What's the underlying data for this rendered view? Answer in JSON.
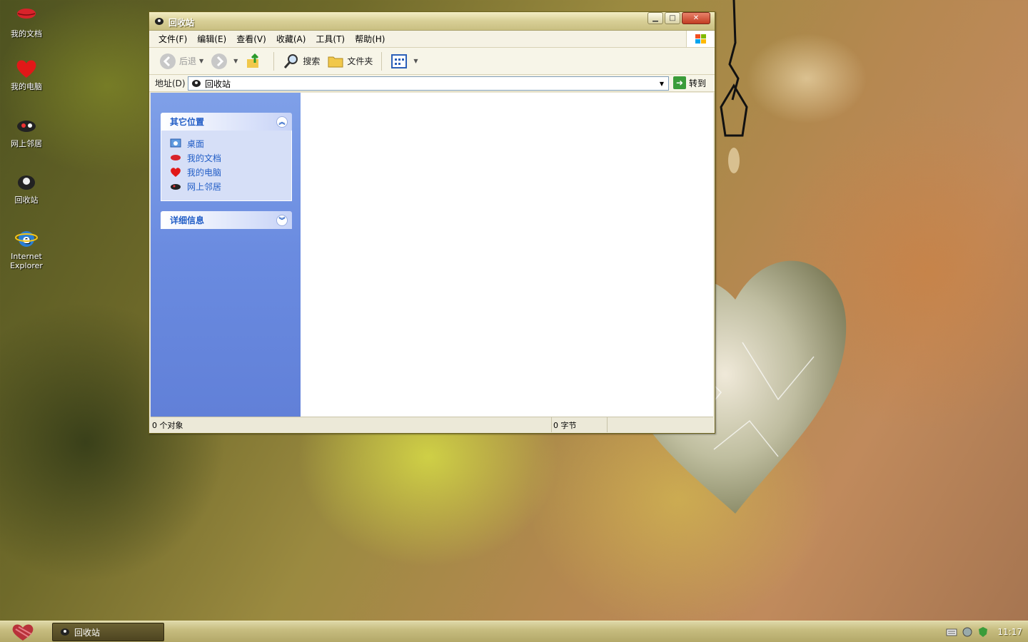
{
  "desktop": {
    "icons": [
      {
        "label": "我的文档",
        "icon": "lips-icon"
      },
      {
        "label": "我的电脑",
        "icon": "heart-icon"
      },
      {
        "label": "网上邻居",
        "icon": "network-icon"
      },
      {
        "label": "回收站",
        "icon": "recycle-bin-icon"
      },
      {
        "label": "Internet\nExplorer",
        "icon": "ie-icon"
      }
    ]
  },
  "window": {
    "title": "回收站",
    "menu": [
      "文件(F)",
      "编辑(E)",
      "查看(V)",
      "收藏(A)",
      "工具(T)",
      "帮助(H)"
    ],
    "toolbar": {
      "back": "后退",
      "search": "搜索",
      "folders": "文件夹"
    },
    "address": {
      "label": "地址(D)",
      "value": "回收站",
      "go": "转到"
    },
    "sidebar": {
      "other_places": {
        "title": "其它位置",
        "links": [
          "桌面",
          "我的文档",
          "我的电脑",
          "网上邻居"
        ]
      },
      "details": {
        "title": "详细信息"
      }
    },
    "status": {
      "objects": "0 个对象",
      "size": "0 字节"
    }
  },
  "taskbar": {
    "task": "回收站",
    "clock": "11:17"
  },
  "colors": {
    "link": "#215dc6",
    "sidebar": "#6a8be0",
    "taskbar": "#c7bd80"
  }
}
